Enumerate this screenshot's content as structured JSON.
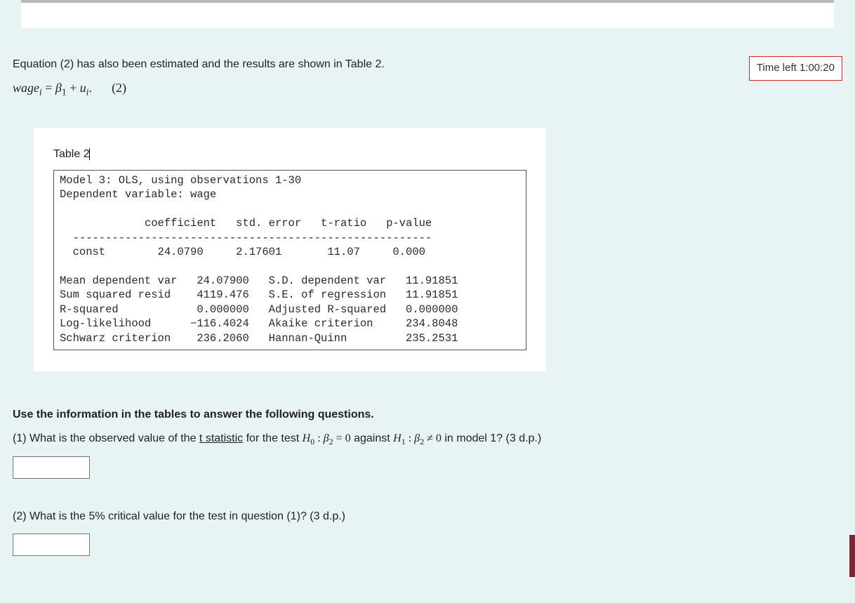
{
  "timer": {
    "label": "Time left 1:00:20"
  },
  "intro": "Equation (2) has also been estimated and the results are shown in Table 2.",
  "equation": {
    "lhs": "wage",
    "lhs_sub": "i",
    "eq": " = ",
    "b1": "β",
    "b1sub": "1",
    "plus": " + ",
    "u": "u",
    "usub": "i",
    "dot": ".",
    "num": "(2)"
  },
  "table": {
    "caption": "Table 2",
    "header_line1": "Model 3: OLS, using observations 1-30",
    "header_line2": "Dependent variable: wage",
    "col_header": "             coefficient   std. error   t-ratio   p-value",
    "divider": "  -------------------------------------------------------",
    "row_const": "  const        24.0790     2.17601       11.07     0.000",
    "stats": {
      "r1": "Mean dependent var   24.07900   S.D. dependent var   11.91851",
      "r2": "Sum squared resid    4119.476   S.E. of regression   11.91851",
      "r3": "R-squared            0.000000   Adjusted R-squared   0.000000",
      "r4": "Log-likelihood      −116.4024   Akaike criterion     234.8048",
      "r5": "Schwarz criterion    236.2060   Hannan-Quinn         235.2531"
    }
  },
  "questions": {
    "heading": "Use the information in the tables to answer the following questions.",
    "q1": {
      "prefix": "(1) What is the observed value of the ",
      "underline": "t statistic",
      "mid": " for the test ",
      "h0": "H",
      "h0sub": "0",
      "colon": " : ",
      "b2": "β",
      "b2sub": "2",
      "eq0": " = 0",
      "against": " against ",
      "h1": "H",
      "h1sub": "1",
      "b2b": "β",
      "b2bsub": "2",
      "neq": " ≠ 0",
      "tail": "  in model 1? (3 d.p.)"
    },
    "q2": {
      "text": "(2) What is the 5% critical value for the  test in question (1)? (3 d.p.)"
    }
  }
}
